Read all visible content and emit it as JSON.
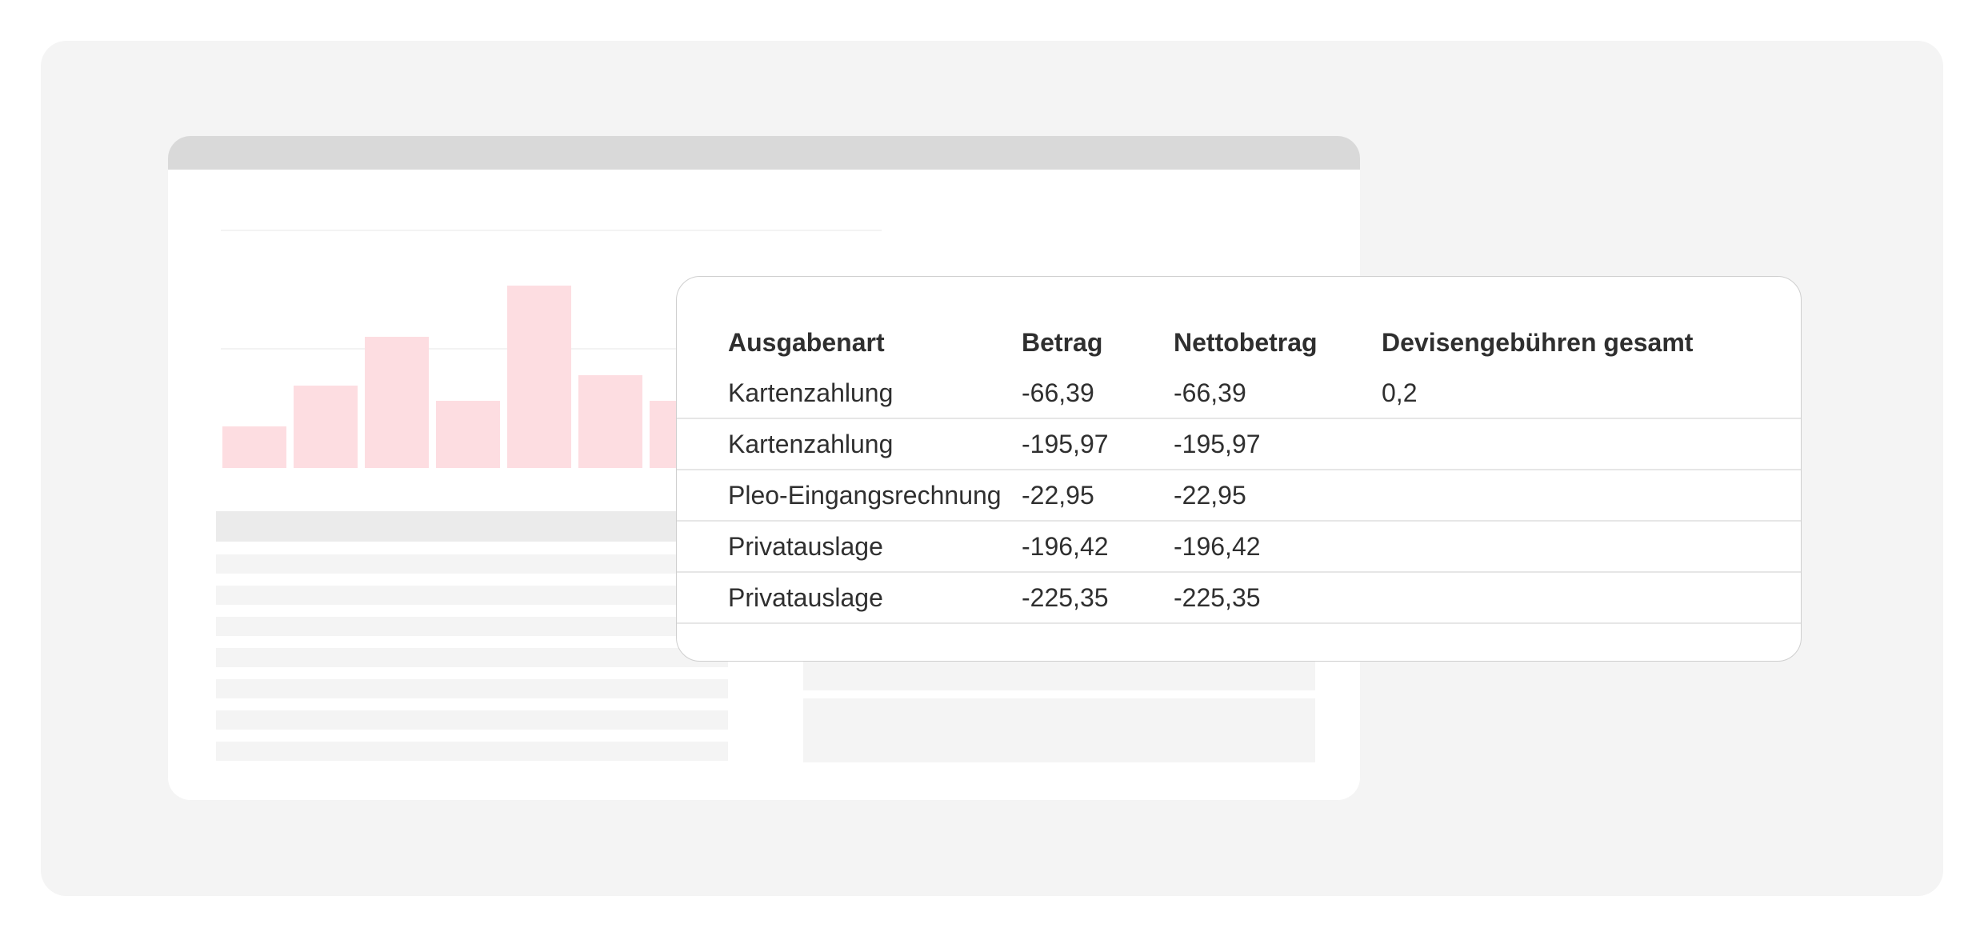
{
  "table": {
    "headers": [
      "Ausgabenart",
      "Betrag",
      "Nettobetrag",
      "Devisengebühren gesamt"
    ],
    "rows": [
      {
        "type": "Kartenzahlung",
        "amount": "-66,39",
        "net": "-66,39",
        "fx_fees": "0,2"
      },
      {
        "type": "Kartenzahlung",
        "amount": "-195,97",
        "net": "-195,97",
        "fx_fees": ""
      },
      {
        "type": "Pleo-Eingangsrechnung",
        "amount": "-22,95",
        "net": "-22,95",
        "fx_fees": ""
      },
      {
        "type": "Privatauslage",
        "amount": "-196,42",
        "net": "-196,42",
        "fx_fees": ""
      },
      {
        "type": "Privatauslage",
        "amount": "-225,35",
        "net": "-225,35",
        "fx_fees": ""
      }
    ]
  },
  "background_chart": {
    "values": [
      0.23,
      0.45,
      0.72,
      0.37,
      1.0,
      0.51,
      0.37
    ],
    "bar_color": "#fddde1"
  },
  "colors": {
    "backdrop": "#f4f4f4",
    "titlebar": "#d9d9d9",
    "text": "#2f2f2f",
    "divider": "#e6e6e6"
  }
}
